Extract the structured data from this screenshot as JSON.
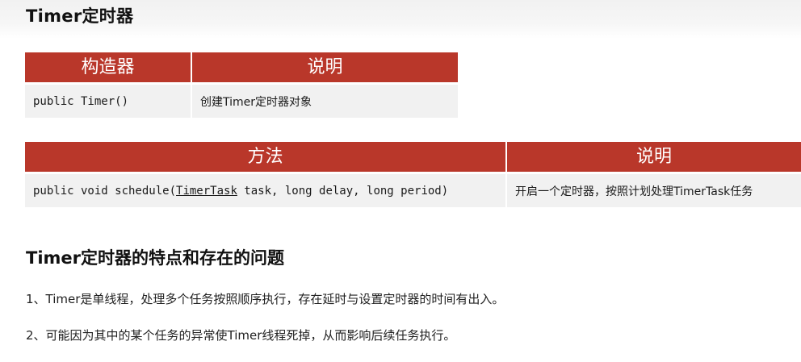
{
  "page": {
    "title": "Timer定时器"
  },
  "constructor_table": {
    "headers": [
      "构造器",
      "说明"
    ],
    "rows": [
      {
        "signature": "public Timer()",
        "description": "创建Timer定时器对象"
      }
    ]
  },
  "method_table": {
    "headers": [
      "方法",
      "说明"
    ],
    "rows": [
      {
        "signature_before": "public void schedule(",
        "signature_link": "TimerTask",
        "signature_after": " task, long delay, long period)",
        "description": "开启一个定时器，按照计划处理TimerTask任务"
      }
    ]
  },
  "issues": {
    "heading": "Timer定时器的特点和存在的问题",
    "points": [
      "1、Timer是单线程，处理多个任务按照顺序执行，存在延时与设置定时器的时间有出入。",
      "2、可能因为其中的某个任务的异常使Timer线程死掉，从而影响后续任务执行。"
    ]
  },
  "colors": {
    "header_bg": "#b9372a",
    "row_bg": "#f1f1f1"
  }
}
